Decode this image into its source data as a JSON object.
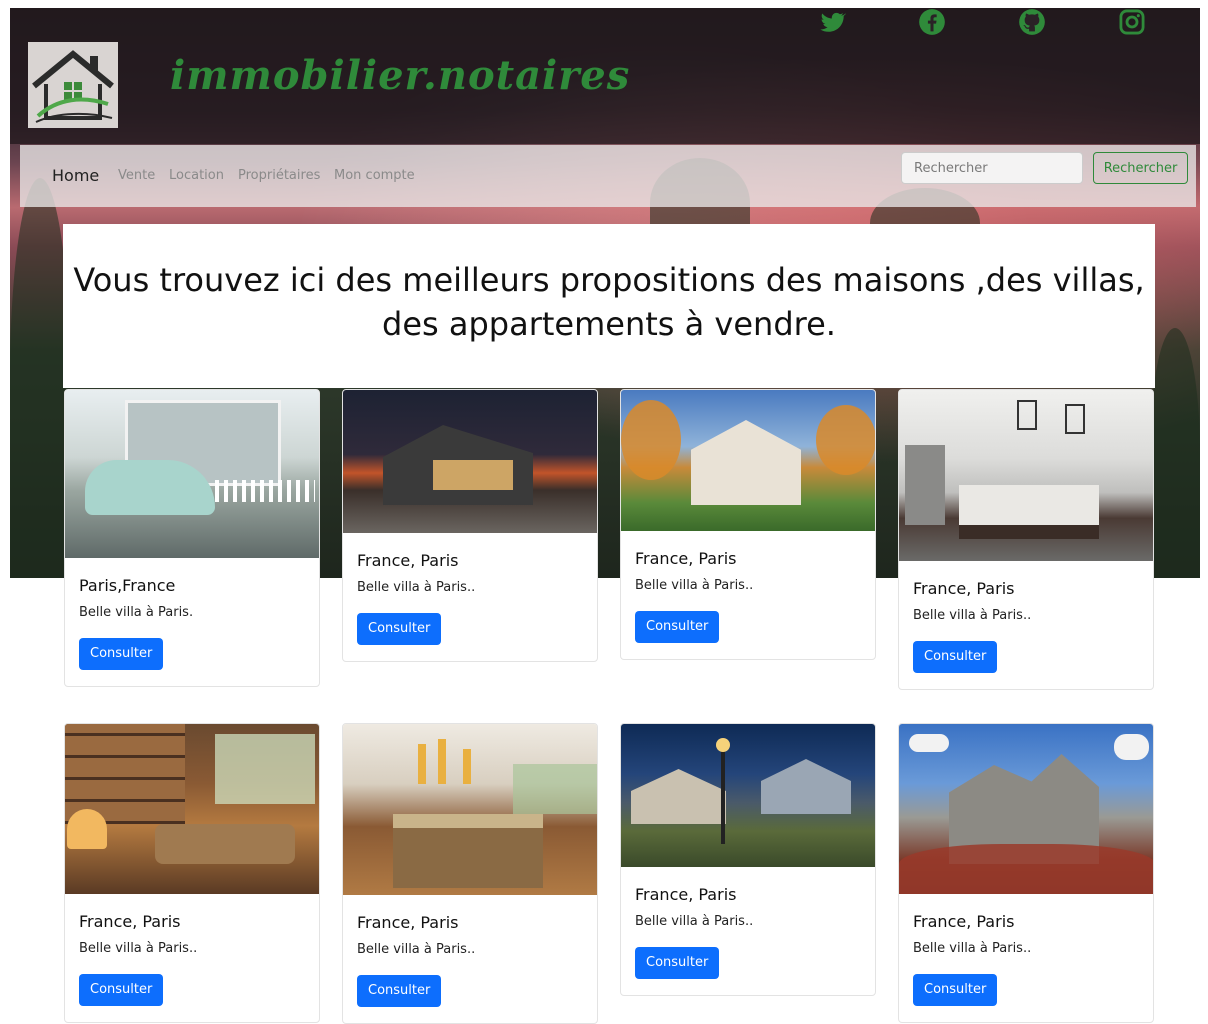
{
  "brand": "immobilier.notaires",
  "colors": {
    "accent_green": "#2f8a3a",
    "button_blue": "#0d6efd"
  },
  "social_icons": [
    "twitter-icon",
    "facebook-icon",
    "github-icon",
    "instagram-icon"
  ],
  "nav": {
    "home": "Home",
    "links": [
      "Vente",
      "Location",
      "Propriétaires",
      "Mon compte"
    ]
  },
  "search": {
    "placeholder": "Rechercher",
    "button": "Rechercher"
  },
  "headline": "Vous trouvez ici des meilleurs propositions des maisons ,des villas, des appartements à vendre.",
  "cards": [
    {
      "title": "Paris,France",
      "text": "Belle villa à Paris.",
      "button": "Consulter"
    },
    {
      "title": "France, Paris",
      "text": "Belle villa à Paris..",
      "button": "Consulter"
    },
    {
      "title": "France, Paris",
      "text": "Belle villa à Paris..",
      "button": "Consulter"
    },
    {
      "title": "France, Paris",
      "text": "Belle villa à Paris..",
      "button": "Consulter"
    },
    {
      "title": "France, Paris",
      "text": "Belle villa à Paris..",
      "button": "Consulter"
    },
    {
      "title": "France, Paris",
      "text": "Belle villa à Paris..",
      "button": "Consulter"
    },
    {
      "title": "France, Paris",
      "text": "Belle villa à Paris..",
      "button": "Consulter"
    },
    {
      "title": "France, Paris",
      "text": "Belle villa à Paris..",
      "button": "Consulter"
    }
  ]
}
